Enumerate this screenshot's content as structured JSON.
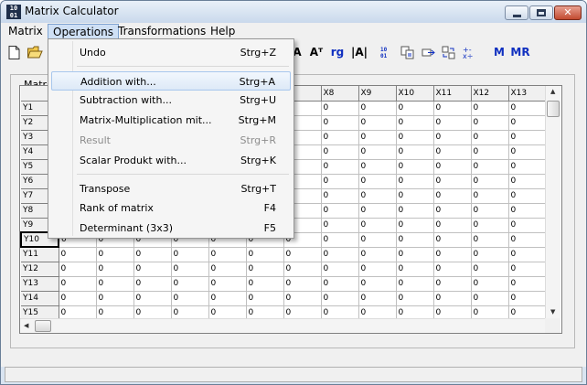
{
  "window": {
    "title": "Matrix Calculator",
    "icon_text": "10 01"
  },
  "menubar": {
    "items": [
      "Matrix",
      "Operations",
      "Transformations",
      "Help"
    ],
    "open_index": 1
  },
  "toolbar": {
    "text_buttons": [
      "A",
      "Aᵀ",
      "rg",
      "|A|",
      "M",
      "MR"
    ]
  },
  "group": {
    "label": "Matrix"
  },
  "grid": {
    "visible_col_headers": [
      "X8",
      "X9",
      "X10",
      "X11",
      "X12",
      "X13"
    ],
    "rows": [
      "Y1",
      "Y2",
      "Y3",
      "Y4",
      "Y5",
      "Y6",
      "Y7",
      "Y8",
      "Y9",
      "Y10",
      "Y11",
      "Y12",
      "Y13",
      "Y14",
      "Y15"
    ],
    "cell_value": "0"
  },
  "operations_menu": {
    "items": [
      {
        "label": "Undo",
        "shortcut": "Strg+Z",
        "state": "normal"
      },
      {
        "label": "Addition with...",
        "shortcut": "Strg+A",
        "state": "hover"
      },
      {
        "label": "Subtraction with...",
        "shortcut": "Strg+U",
        "state": "normal"
      },
      {
        "label": "Matrix-Multiplication mit...",
        "shortcut": "Strg+M",
        "state": "normal"
      },
      {
        "label": "Result",
        "shortcut": "Strg+R",
        "state": "disabled"
      },
      {
        "label": "Scalar Produkt with...",
        "shortcut": "Strg+K",
        "state": "normal"
      },
      {
        "label": "Transpose",
        "shortcut": "Strg+T",
        "state": "normal"
      },
      {
        "label": "Rank of matrix",
        "shortcut": "F4",
        "state": "normal"
      },
      {
        "label": "Determinant (3x3)",
        "shortcut": "F5",
        "state": "normal"
      }
    ]
  },
  "colors": {
    "hover_fill": "#dde9f7",
    "menu_open_fill": "#cfe0f5",
    "accent_blue": "#1030c0"
  }
}
